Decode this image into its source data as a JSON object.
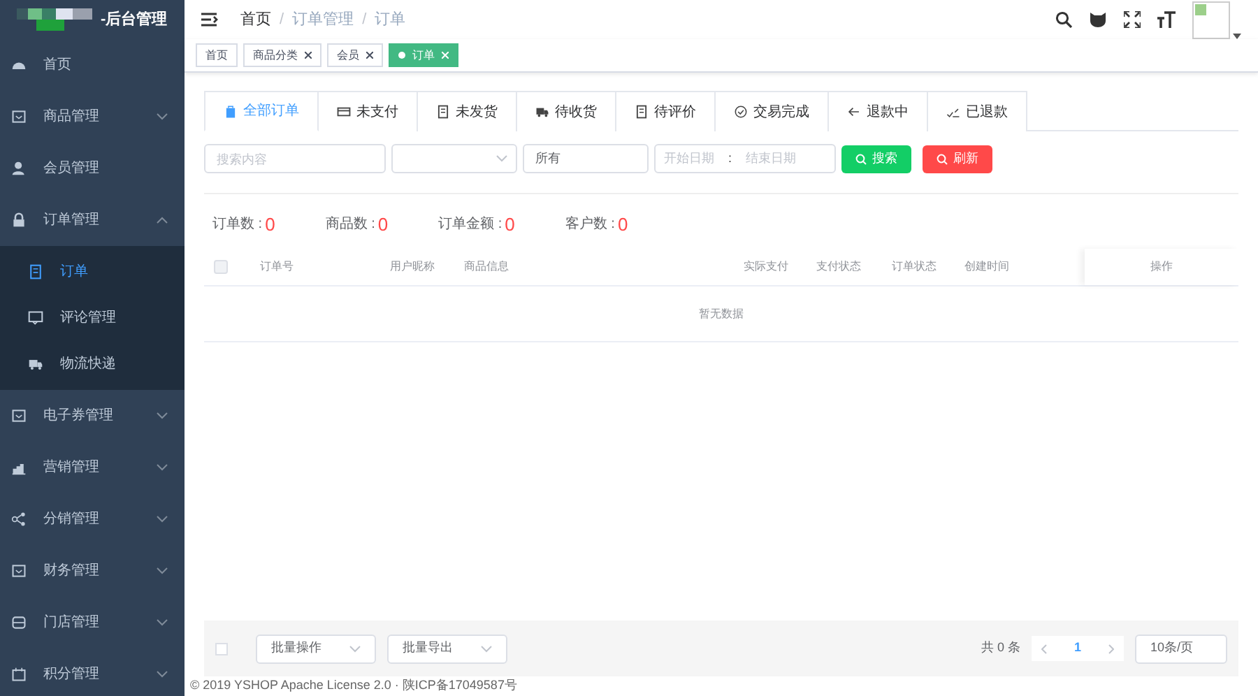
{
  "logo": {
    "title": "-后台管理"
  },
  "sidebar": {
    "items": [
      {
        "label": "首页",
        "kind": "link"
      },
      {
        "label": "商品管理",
        "kind": "group",
        "expanded": false
      },
      {
        "label": "会员管理",
        "kind": "link"
      },
      {
        "label": "订单管理",
        "kind": "group",
        "expanded": true,
        "children": [
          {
            "label": "订单",
            "selected": true
          },
          {
            "label": "评论管理",
            "selected": false
          },
          {
            "label": "物流快递",
            "selected": false
          }
        ]
      },
      {
        "label": "电子券管理",
        "kind": "group",
        "expanded": false
      },
      {
        "label": "营销管理",
        "kind": "group",
        "expanded": false
      },
      {
        "label": "分销管理",
        "kind": "group",
        "expanded": false
      },
      {
        "label": "财务管理",
        "kind": "group",
        "expanded": false
      },
      {
        "label": "门店管理",
        "kind": "group",
        "expanded": false
      },
      {
        "label": "积分管理",
        "kind": "group",
        "expanded": false
      }
    ]
  },
  "breadcrumb": {
    "separator": "/",
    "items": [
      "首页",
      "订单管理",
      "订单"
    ]
  },
  "tags": [
    {
      "label": "首页",
      "kind": "fixed",
      "selected": false
    },
    {
      "label": "商品分类",
      "kind": "closable",
      "selected": false
    },
    {
      "label": "会员",
      "kind": "closable",
      "selected": false
    },
    {
      "label": "订单",
      "kind": "closable",
      "selected": true
    }
  ],
  "order_tabs": [
    {
      "label": "全部订单",
      "selected": true
    },
    {
      "label": "未支付",
      "selected": false
    },
    {
      "label": "未发货",
      "selected": false
    },
    {
      "label": "待收货",
      "selected": false
    },
    {
      "label": "待评价",
      "selected": false
    },
    {
      "label": "交易完成",
      "selected": false
    },
    {
      "label": "退款中",
      "selected": false
    },
    {
      "label": "已退款",
      "selected": false
    }
  ],
  "filters": {
    "search_placeholder": "搜索内容",
    "type_value": "所有",
    "start_placeholder": "开始日期",
    "separator": ":",
    "end_placeholder": "结束日期",
    "search_button": "搜索",
    "refresh_button": "刷新"
  },
  "stats": [
    {
      "label": "订单数 :",
      "value": "0"
    },
    {
      "label": "商品数 :",
      "value": "0"
    },
    {
      "label": "订单金额 :",
      "value": "0"
    },
    {
      "label": "客户数 :",
      "value": "0"
    }
  ],
  "table": {
    "select_all_checked": false,
    "columns": [
      "订单号",
      "用户昵称",
      "商品信息",
      "实际支付",
      "支付状态",
      "订单状态",
      "创建时间",
      "操作"
    ],
    "empty_text": "暂无数据"
  },
  "footer_bar": {
    "select_checked": false,
    "batch_action": "批量操作",
    "batch_export": "批量导出",
    "total": "共 0 条",
    "page": "1",
    "page_size": "10条/页"
  },
  "copyright": "© 2019 YSHOP Apache License 2.0 · 陕ICP备17049587号"
}
